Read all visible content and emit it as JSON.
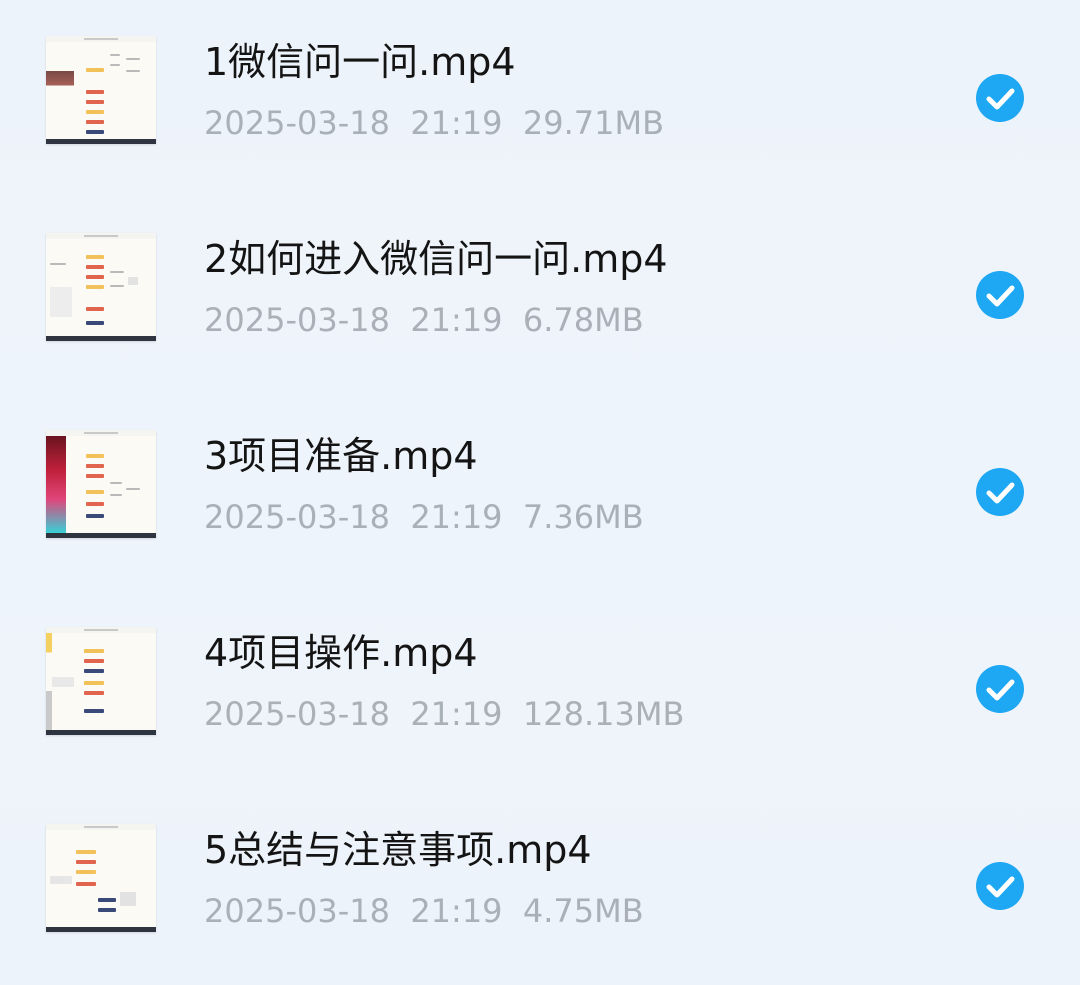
{
  "files": [
    {
      "name": "1微信问一问.mp4",
      "date": "2025-03-18",
      "time": "21:19",
      "size": "29.71MB",
      "selected": true,
      "icon": "check-circle-icon"
    },
    {
      "name": "2如何进入微信问一问.mp4",
      "date": "2025-03-18",
      "time": "21:19",
      "size": "6.78MB",
      "selected": true,
      "icon": "check-circle-icon"
    },
    {
      "name": "3项目准备.mp4",
      "date": "2025-03-18",
      "time": "21:19",
      "size": "7.36MB",
      "selected": true,
      "icon": "check-circle-icon"
    },
    {
      "name": "4项目操作.mp4",
      "date": "2025-03-18",
      "time": "21:19",
      "size": "128.13MB",
      "selected": true,
      "icon": "check-circle-icon"
    },
    {
      "name": "5总结与注意事项.mp4",
      "date": "2025-03-18",
      "time": "21:19",
      "size": "4.75MB",
      "selected": true,
      "icon": "check-circle-icon"
    }
  ],
  "colors": {
    "background": "#edf3fa",
    "title_text": "#141414",
    "meta_text": "#a9b0b8",
    "check_accent": "#1ea7f2"
  }
}
